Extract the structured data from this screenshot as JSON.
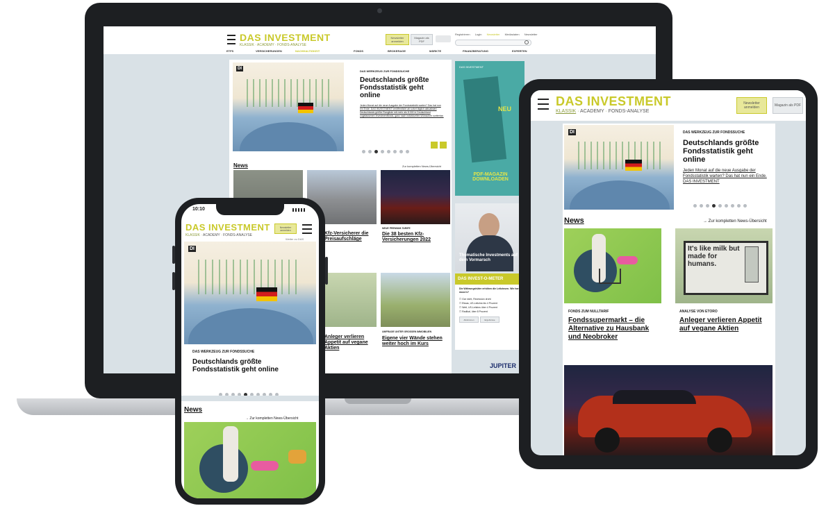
{
  "site": {
    "logo": "DAS INVESTMENT",
    "sub_links": [
      "KLASSIK",
      "ACADEMY",
      "FONDS-ANALYSE"
    ],
    "newsletter_button": "Newsletter anmelden",
    "magazine_button": "Magazin als PDF"
  },
  "desktop": {
    "top_links": [
      "Registrieren",
      "Login",
      "Newsletter",
      "Mediadaten",
      "Newsletter"
    ],
    "nav": [
      "ETFS",
      "VERSICHERUNGEN",
      "NACHHALTIGKEIT",
      "FONDS",
      "BROKERAGE",
      "MÄRKTE",
      "FINANZBERATUNG",
      "EXPERTEN"
    ],
    "hero": {
      "badge": "DI",
      "kicker": "DAS WERKZEUG ZUR FONDSSUCHE",
      "title": "Deutschlands größte Fondsstatistik geht online",
      "excerpt": "Jeden Monat auf die neue Ausgabe der Fondsstatistik warten? Das hat nun ein Ende. DAS INVESTMENT veröffentlicht ab sofort täglich aktualisiert Deutschlands größte Rangliste mit mehr als 8.000 in Deutschland zugelassenen Investmentfonds, ganz nach individuellen Wünschen sortierbar."
    },
    "news_heading": "News",
    "news_link": "Zur kompletten News-Übersicht",
    "cards": [
      {
        "kicker": "",
        "title": ""
      },
      {
        "kicker": "",
        "title": "Kfz-Versicherer die Preisaufschläge"
      },
      {
        "kicker": "NEUE PREMIUM-TARIFE",
        "title": "Die 38 besten Kfz-Versicherungen 2022"
      },
      {
        "kicker": "",
        "title": "Anleger verlieren Appetit auf vegane Aktien"
      },
      {
        "kicker": "",
        "title": "Anleger verlieren Appetit auf vegane Aktien"
      },
      {
        "kicker": "UMFRAGE UNTER GROSSEN IMMOBILIEN",
        "title": "Eigene vier Wände stehen weiter hoch im Kurs"
      }
    ],
    "ad": {
      "neu": "NEU",
      "title": "PDF-MAGAZIN DOWNLOADEN",
      "label": "DAS INVESTMENT"
    },
    "man_caption": "Thematische Investments auf dem Vormarsch",
    "poll": {
      "title": "DAS INVEST-O-METER",
      "question": "Die Währungshüter erhöhen die Leitzinsen. Wie hart muss's?",
      "options": [
        "Gar nicht, Rezession droht",
        "Etwas, US-Leitzins bis 4 Prozent",
        "Weit, US-Leitzins über 4 Prozent",
        "Radikal, über 8 Prozent"
      ],
      "buttons": [
        "Abstimmen",
        "Ergebnisse"
      ]
    },
    "sponsor": "JUPITER"
  },
  "tablet": {
    "hero": {
      "badge": "DI",
      "kicker": "DAS WERKZEUG ZUR FONDSSUCHE",
      "title": "Deutschlands größte Fondsstatistik geht online",
      "excerpt": "Jeden Monat auf die neue Ausgabe der Fondsstatistik warten? Das hat nun ein Ende. DAS INVESTMENT"
    },
    "news_heading": "News",
    "news_link": "Zur kompletten News-Übersicht",
    "cards": [
      {
        "kicker": "FONDS ZUM NULLTARIF",
        "title": "Fondssupermarkt – die Alternative zu Hausbank und Neobroker"
      },
      {
        "kicker": "ANALYSE VON ETORO",
        "title": "Anleger verlieren Appetit auf vegane Aktien"
      }
    ],
    "billboard_text": "It's like milk but made for humans."
  },
  "phone": {
    "time": "10:10",
    "hero": {
      "badge": "DI",
      "kicker": "DAS WERKZEUG ZUR FONDSSUCHE",
      "title": "Deutschlands größte Fondsstatistik geht online"
    },
    "news_heading": "News",
    "news_link": "Zur kompletten News-Übersicht",
    "side_link": "Weiter zu DAS"
  },
  "colors": {
    "brand": "#c9c92a",
    "device": "#1d1f22",
    "page_bg": "#d9e1e6"
  }
}
